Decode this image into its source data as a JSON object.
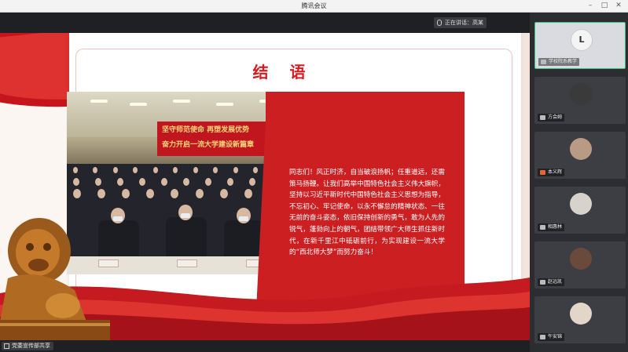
{
  "window": {
    "title": "腾讯会议"
  },
  "speaker": {
    "label": "正在讲话：高某"
  },
  "slide": {
    "heading": "结  语",
    "photo_banner_line1": "坚守师范使命  再塑发展优势",
    "photo_banner_line2": "奋力开启一流大学建设新篇章",
    "body": "同志们！风正时济，自当破浪扬帆；任重道远，还需策马扬鞭。让我们高举中国特色社会主义伟大旗帜，坚持以习近平新时代中国特色社会主义思想为指导，不忘初心、牢记使命，以永不懈怠的精神状态、一往无前的奋斗姿态，依旧保持创新的勇气，敢为人先的锐气，蓬勃向上的朝气，团结带领广大师生抓住新时代，在新千里江中砥砺前行，为实现建设一流大学的“西北师大梦”而努力奋斗！"
  },
  "participants": [
    {
      "name": "学校院系教学",
      "avatar": "L",
      "active": true,
      "mic": "on"
    },
    {
      "name": "方会姆",
      "avatar": "",
      "active": false,
      "mic": "on"
    },
    {
      "name": "本义辉",
      "avatar": "",
      "active": false,
      "mic": "off"
    },
    {
      "name": "相惠林",
      "avatar": "",
      "active": false,
      "mic": "on"
    },
    {
      "name": "赵远凯",
      "avatar": "",
      "active": false,
      "mic": "on"
    },
    {
      "name": "午安锦",
      "avatar": "",
      "active": false,
      "mic": "on"
    }
  ],
  "share_badge": {
    "label": "党委宣传部共享"
  },
  "colors": {
    "accent_red": "#cc1f22",
    "active_border": "#36c27a"
  }
}
